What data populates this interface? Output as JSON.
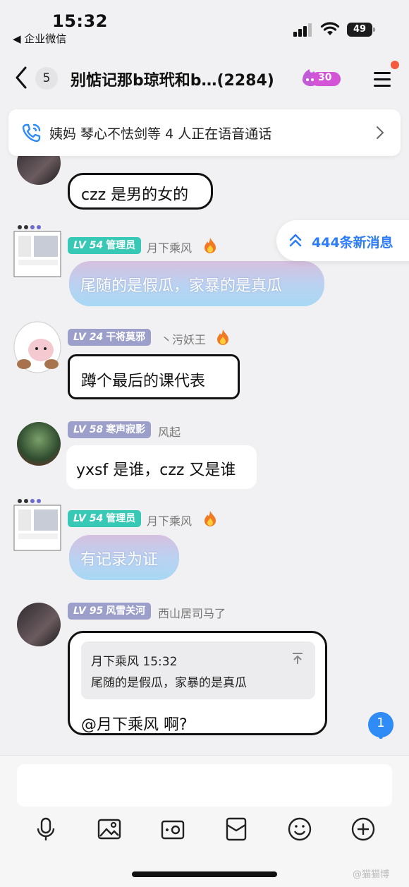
{
  "status_bar": {
    "time": "15:32",
    "back_app": "◀ 企业微信",
    "battery": "49"
  },
  "header": {
    "unread_count": "5",
    "title": "别惦记那b琼玳和b…(2284)",
    "fire_level": "30"
  },
  "voice_banner": {
    "text": "姨妈  琴心不怯剑等 4 人正在语音通话"
  },
  "new_messages": {
    "label": "444条新消息"
  },
  "messages": [
    {
      "text": "czz 是男的女的"
    },
    {
      "level": "LV 54",
      "title": "管理员",
      "sender": "月下乘风",
      "text": "尾随的是假瓜，家暴的是真瓜"
    },
    {
      "level": "LV 24",
      "title": "干将莫邪",
      "sender": "丶污妖王",
      "text": "蹲个最后的课代表"
    },
    {
      "level": "LV 58",
      "title": "寒声寂影",
      "sender": "风起",
      "text": "yxsf 是谁，czz 又是谁"
    },
    {
      "level": "LV 54",
      "title": "管理员",
      "sender": "月下乘风",
      "text": "有记录为证"
    },
    {
      "level": "LV 95",
      "title": "风雪关河",
      "sender": "西山居司马了",
      "quote_meta": "月下乘风 15:32",
      "quote_text": "尾随的是假瓜，家暴的是真瓜",
      "text": "@月下乘风 啊?"
    }
  ],
  "unread_bubble": "1",
  "input": {
    "placeholder": ""
  },
  "toolbar_icons": [
    "microphone-icon",
    "image-icon",
    "camera-icon",
    "red-packet-icon",
    "emoji-icon",
    "plus-icon"
  ],
  "watermark": "@猫猫博"
}
